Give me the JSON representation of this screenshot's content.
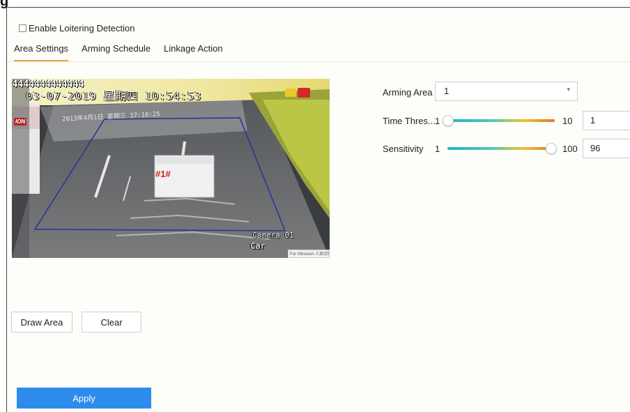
{
  "header": {
    "title_fragment": "g"
  },
  "enable_checkbox": {
    "label": "Enable Loitering Detection",
    "checked": false
  },
  "tabs": [
    {
      "label": "Area Settings",
      "active": true
    },
    {
      "label": "Arming Schedule",
      "active": false
    },
    {
      "label": "Linkage Action",
      "active": false
    }
  ],
  "preview": {
    "osd_id": "4444444444444",
    "osd_datetime": "03-07-2019  星期四  10:54:53",
    "inner_osd": "2013年4月1日 星期三 17:10:25",
    "inner_brand": "ION",
    "zone_label": "#1#",
    "camera_label": "Camera 01",
    "car_label": "Car",
    "badge_text": "For Hikvision 人脸识别 预览"
  },
  "arming_area": {
    "label": "Arming Area",
    "value": "1"
  },
  "time_threshold": {
    "label": "Time Thres...",
    "min": "1",
    "max": "10",
    "value": "1",
    "level_fraction": 0.0
  },
  "sensitivity": {
    "label": "Sensitivity",
    "min": "1",
    "max": "100",
    "value": "96",
    "level_fraction": 0.96
  },
  "buttons": {
    "draw_area": "Draw Area",
    "clear": "Clear",
    "apply": "Apply"
  },
  "colors": {
    "accent": "#2d8ceb",
    "tab_underline": "#e8a24a",
    "zone_line": "#2d2f9c",
    "zone_label": "#d9221c"
  },
  "icons": [
    "chevron-down-icon",
    "alarm-icon",
    "record-icon"
  ]
}
